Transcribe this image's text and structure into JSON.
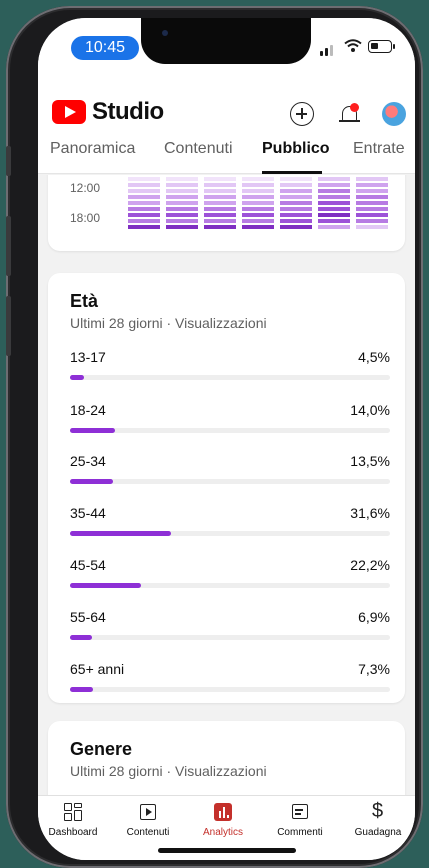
{
  "status_bar": {
    "time": "10:45"
  },
  "app": {
    "name": "Studio"
  },
  "tabs": [
    {
      "label": "Panoramica",
      "active": false
    },
    {
      "label": "Contenuti",
      "active": false
    },
    {
      "label": "Pubblico",
      "active": true
    },
    {
      "label": "Entrate",
      "active": false
    }
  ],
  "heatmap": {
    "time_labels": [
      "12:00",
      "18:00"
    ]
  },
  "age_card": {
    "title": "Età",
    "subtitle": "Ultimi 28 giorni · Visualizzazioni",
    "rows": [
      {
        "label": "13-17",
        "pct_text": "4,5%",
        "fraction": 0.045
      },
      {
        "label": "18-24",
        "pct_text": "14,0%",
        "fraction": 0.14
      },
      {
        "label": "25-34",
        "pct_text": "13,5%",
        "fraction": 0.135
      },
      {
        "label": "35-44",
        "pct_text": "31,6%",
        "fraction": 0.316
      },
      {
        "label": "45-54",
        "pct_text": "22,2%",
        "fraction": 0.222
      },
      {
        "label": "55-64",
        "pct_text": "6,9%",
        "fraction": 0.069
      },
      {
        "label": "65+ anni",
        "pct_text": "7,3%",
        "fraction": 0.073
      }
    ]
  },
  "gender_card": {
    "title": "Genere",
    "subtitle": "Ultimi 28 giorni · Visualizzazioni"
  },
  "bottom_nav": [
    {
      "label": "Dashboard",
      "icon": "dashboard-icon",
      "active": false
    },
    {
      "label": "Contenuti",
      "icon": "content-icon",
      "active": false
    },
    {
      "label": "Analytics",
      "icon": "analytics-icon",
      "active": true
    },
    {
      "label": "Commenti",
      "icon": "comments-icon",
      "active": false
    },
    {
      "label": "Guadagna",
      "icon": "earn-icon",
      "active": false
    }
  ],
  "colors": {
    "accent_purple": "#8e2fd6",
    "youtube_red": "#ff0000",
    "analytics_red": "#c4302b",
    "time_pill_blue": "#1a73e8"
  }
}
